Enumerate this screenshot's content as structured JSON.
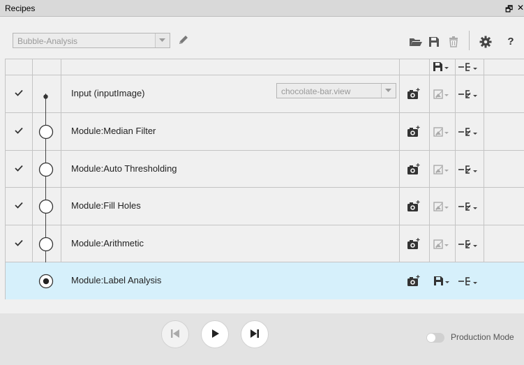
{
  "window": {
    "title": "Recipes",
    "restore_glyph": "🗗",
    "close_glyph": "✕"
  },
  "toolbar": {
    "recipe_value": "Bubble-Analysis",
    "icons": [
      "pencil-icon",
      "folder-open-icon",
      "save-icon",
      "trash-icon",
      "gear-icon",
      "help-icon"
    ],
    "help_label": "?"
  },
  "header": {
    "icons": [
      "save-dropdown-icon",
      "export-dropdown-icon"
    ]
  },
  "rows": [
    {
      "checked": true,
      "node": "dot",
      "name": "Input (inputImage)",
      "view_value": "chocolate-bar.view",
      "selected": false
    },
    {
      "checked": true,
      "node": "circle",
      "name": "Module:Median Filter",
      "selected": false
    },
    {
      "checked": true,
      "node": "circle",
      "name": "Module:Auto Thresholding",
      "selected": false
    },
    {
      "checked": true,
      "node": "circle",
      "name": "Module:Fill Holes",
      "selected": false
    },
    {
      "checked": true,
      "node": "circle",
      "name": "Module:Arithmetic",
      "selected": false
    },
    {
      "checked": false,
      "node": "selected",
      "name": "Module:Label Analysis",
      "selected": true
    }
  ],
  "footer": {
    "buttons": [
      "skip-back-icon",
      "play-icon",
      "step-forward-icon"
    ],
    "production_mode_label": "Production Mode",
    "production_mode_on": false
  },
  "colors": {
    "selected_row": "#d6f0fb",
    "grid_line": "#c4c4c4",
    "bottom_bar": "#e3e3e3"
  }
}
